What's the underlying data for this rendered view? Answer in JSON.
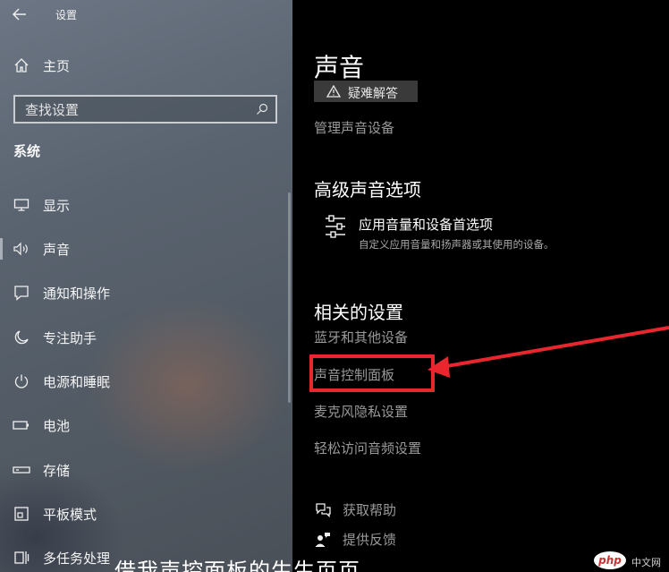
{
  "window": {
    "title": "设置"
  },
  "sidebar": {
    "home": "主页",
    "search_placeholder": "查找设置",
    "section": "系统",
    "items": [
      {
        "label": "显示",
        "icon": "monitor-icon"
      },
      {
        "label": "声音",
        "icon": "speaker-icon",
        "selected": true
      },
      {
        "label": "通知和操作",
        "icon": "notification-icon"
      },
      {
        "label": "专注助手",
        "icon": "moon-icon"
      },
      {
        "label": "电源和睡眠",
        "icon": "power-icon"
      },
      {
        "label": "电池",
        "icon": "battery-icon"
      },
      {
        "label": "存储",
        "icon": "storage-icon"
      },
      {
        "label": "平板模式",
        "icon": "tablet-mode-icon"
      },
      {
        "label": "多任务处理",
        "icon": "multitasking-icon"
      }
    ]
  },
  "content": {
    "title": "声音",
    "troubleshoot": "疑难解答",
    "manage_devices": "管理声音设备",
    "advanced": {
      "heading": "高级声音选项",
      "app_volume_title": "应用音量和设备首选项",
      "app_volume_desc": "自定义应用音量和扬声器或其使用的设备。"
    },
    "related": {
      "heading": "相关的设置",
      "links": [
        "蓝牙和其他设备",
        "声音控制面板",
        "麦克风隐私设置",
        "轻松访问音频设置"
      ]
    },
    "help": {
      "get_help": "获取帮助",
      "feedback": "提供反馈"
    }
  },
  "overlay": {
    "caption": "借我声控面板的生生页页",
    "logo": "php",
    "watermark": "中文网",
    "highlight_color": "#e8262e"
  }
}
